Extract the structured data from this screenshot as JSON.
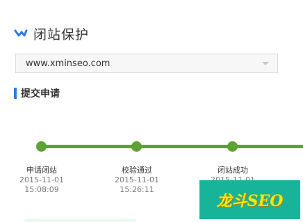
{
  "header": {
    "title": "闭站保护",
    "icon": "chevron-down-icon"
  },
  "site_select": {
    "value": "www.xminseo.com"
  },
  "section": {
    "title": "提交申请"
  },
  "steps": [
    {
      "name": "申请闭站",
      "date": "2015-11-01",
      "time": "15:08:09"
    },
    {
      "name": "校验通过",
      "date": "2015-11-01",
      "time": "15:26:11"
    },
    {
      "name": "闭站成功",
      "date": "2015-11-01",
      "time": ""
    }
  ],
  "watermark": {
    "text": "龙斗SEO"
  },
  "colors": {
    "progress": "#5ca235",
    "accent": "#2c7be5",
    "watermark_bg": "#17b49a",
    "watermark_text": "#ffe600"
  }
}
